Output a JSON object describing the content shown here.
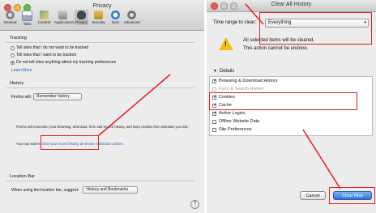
{
  "privacy_window": {
    "title": "Privacy",
    "toolbar": [
      "General",
      "Tabs",
      "Content",
      "Applications",
      "Privacy",
      "Security",
      "Sync",
      "Advanced"
    ],
    "tracking": {
      "heading": "Tracking",
      "options": [
        "Tell sites that I do not want to be tracked",
        "Tell sites that I want to be tracked",
        "Do not tell sites anything about my tracking preferences"
      ],
      "learn_more": "Learn More"
    },
    "history": {
      "heading": "History",
      "will_label": "Firefox will:",
      "will_value": "Remember history",
      "desc": "Firefox will remember your browsing, download, form and search history, and keep cookies from websites you visit.",
      "clear_prefix": "You may want to",
      "clear_link": "clear your recent history",
      "clear_mid": ", or",
      "remove_link": "remove individual cookies",
      "clear_suffix": "."
    },
    "location_bar": {
      "heading": "Location Bar",
      "suggest_label": "When using the location bar, suggest:",
      "suggest_value": "History and Bookmarks"
    }
  },
  "clear_window": {
    "title": "Clear All History",
    "time_range_label": "Time range to clear:",
    "time_range_value": "Everything",
    "warning_line1": "All selected items will be cleared.",
    "warning_line2": "This action cannot be undone.",
    "details_label": "Details",
    "items": [
      {
        "label": "Browsing & Download History",
        "checked": true,
        "disabled": false
      },
      {
        "label": "Form & Search History",
        "checked": false,
        "disabled": true
      },
      {
        "label": "Cookies",
        "checked": true,
        "disabled": false
      },
      {
        "label": "Cache",
        "checked": true,
        "disabled": false
      },
      {
        "label": "Active Logins",
        "checked": true,
        "disabled": false
      },
      {
        "label": "Offline Website Data",
        "checked": false,
        "disabled": false
      },
      {
        "label": "Site Preferences",
        "checked": false,
        "disabled": false
      }
    ],
    "cancel_label": "Cancel",
    "clear_now_label": "Clear Now"
  },
  "colors": {
    "annotation": "#e02020",
    "link": "#1b5fbf",
    "default_button": "#2f74d6"
  }
}
